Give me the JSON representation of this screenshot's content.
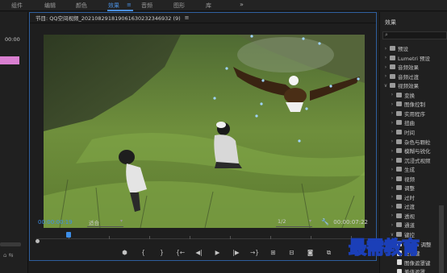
{
  "workspace_tabs": [
    {
      "label": "组件",
      "active": false
    },
    {
      "label": "编辑",
      "active": false
    },
    {
      "label": "颜色",
      "active": false
    },
    {
      "label": "效果",
      "active": true
    },
    {
      "label": "音频",
      "active": false
    },
    {
      "label": "图形",
      "active": false
    },
    {
      "label": "库",
      "active": false
    }
  ],
  "workspace_active_menu_icon": "≡",
  "workspace_more": "»",
  "left_panel": {
    "timecode": "00:00"
  },
  "monitor": {
    "title": "节目: QQ空间视频_20210829181906163023234693​2 (9)",
    "menu_icon": "≡",
    "current_timecode": "00:00:00:19",
    "fit_label": "适合",
    "resolution_label": "1/2",
    "duration_timecode": "00:00:07:22"
  },
  "transport_buttons": [
    {
      "name": "add-marker-icon",
      "glyph": "⬢"
    },
    {
      "name": "mark-in-icon",
      "glyph": "{"
    },
    {
      "name": "mark-out-icon",
      "glyph": "}"
    },
    {
      "name": "go-to-in-icon",
      "glyph": "{←"
    },
    {
      "name": "step-back-icon",
      "glyph": "◀|"
    },
    {
      "name": "play-icon",
      "glyph": "▶"
    },
    {
      "name": "step-forward-icon",
      "glyph": "|▶"
    },
    {
      "name": "go-to-out-icon",
      "glyph": "→}"
    },
    {
      "name": "lift-icon",
      "glyph": "⊞"
    },
    {
      "name": "extract-icon",
      "glyph": "⊟"
    },
    {
      "name": "export-frame-icon",
      "glyph": "◙"
    },
    {
      "name": "comparison-view-icon",
      "glyph": "⧉"
    }
  ],
  "effects_panel": {
    "title": "效果",
    "items": [
      {
        "label": "预设",
        "type": "folder",
        "expanded": false,
        "indent": 0
      },
      {
        "label": "Lumetri 预设",
        "type": "folder",
        "expanded": false,
        "indent": 0
      },
      {
        "label": "音频效果",
        "type": "folder",
        "expanded": false,
        "indent": 0
      },
      {
        "label": "音频过渡",
        "type": "folder",
        "expanded": false,
        "indent": 0
      },
      {
        "label": "视频效果",
        "type": "folder",
        "expanded": true,
        "indent": 0
      },
      {
        "label": "变换",
        "type": "folder",
        "expanded": false,
        "indent": 1
      },
      {
        "label": "图像控制",
        "type": "folder",
        "expanded": false,
        "indent": 1
      },
      {
        "label": "实用程序",
        "type": "folder",
        "expanded": false,
        "indent": 1
      },
      {
        "label": "扭曲",
        "type": "folder",
        "expanded": false,
        "indent": 1
      },
      {
        "label": "时间",
        "type": "folder",
        "expanded": false,
        "indent": 1
      },
      {
        "label": "杂色与颗粒",
        "type": "folder",
        "expanded": false,
        "indent": 1
      },
      {
        "label": "模糊与锐化",
        "type": "folder",
        "expanded": false,
        "indent": 1
      },
      {
        "label": "沉浸式视频",
        "type": "folder",
        "expanded": false,
        "indent": 1
      },
      {
        "label": "生成",
        "type": "folder",
        "expanded": false,
        "indent": 1
      },
      {
        "label": "视频",
        "type": "folder",
        "expanded": false,
        "indent": 1
      },
      {
        "label": "调整",
        "type": "folder",
        "expanded": false,
        "indent": 1
      },
      {
        "label": "过时",
        "type": "folder",
        "expanded": false,
        "indent": 1
      },
      {
        "label": "过渡",
        "type": "folder",
        "expanded": false,
        "indent": 1
      },
      {
        "label": "透视",
        "type": "folder",
        "expanded": false,
        "indent": 1
      },
      {
        "label": "通道",
        "type": "folder",
        "expanded": false,
        "indent": 1
      },
      {
        "label": "键控",
        "type": "folder",
        "expanded": true,
        "indent": 1
      },
      {
        "label": "Alpha 调整",
        "type": "file",
        "expanded": false,
        "indent": 2
      },
      {
        "label": "亮度键",
        "type": "file",
        "expanded": false,
        "indent": 2
      },
      {
        "label": "图像遮罩键",
        "type": "file",
        "expanded": false,
        "indent": 2
      },
      {
        "label": "差值遮罩",
        "type": "file",
        "expanded": false,
        "indent": 2
      },
      {
        "label": "移除遮罩",
        "type": "file",
        "expanded": false,
        "indent": 2
      }
    ]
  },
  "watermark": "最需教育",
  "colors": {
    "accent": "#3d8ee8",
    "selected_border": "#2e5f9e",
    "clip_label": "#d97fd0"
  }
}
